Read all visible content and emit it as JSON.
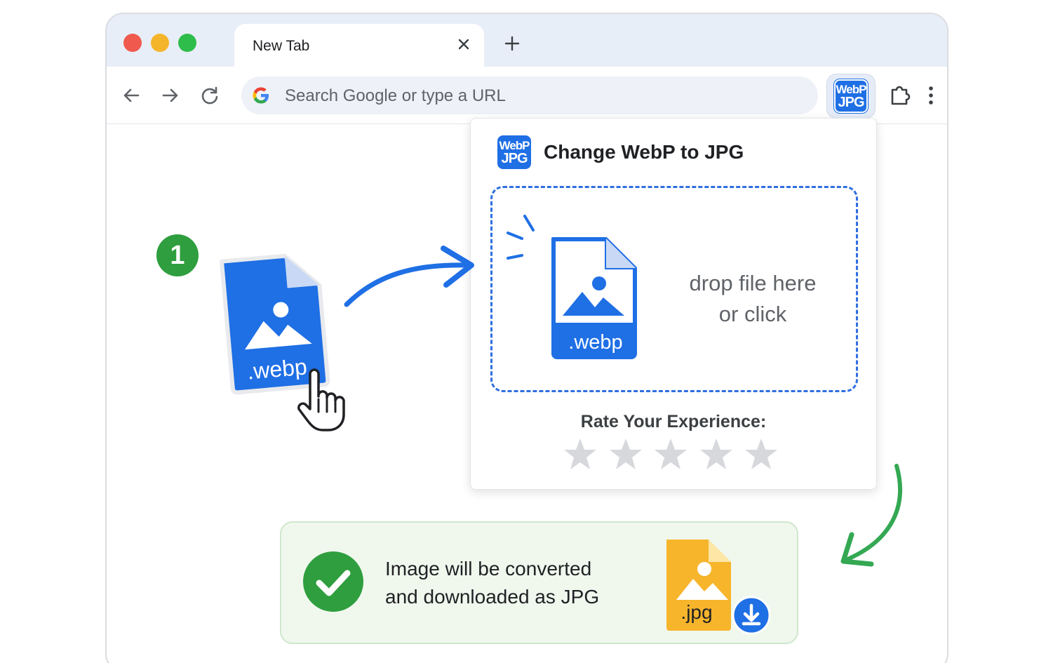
{
  "window": {
    "tab_title": "New Tab"
  },
  "toolbar": {
    "omnibox_placeholder": "Search Google or type a URL",
    "extension_icon": {
      "line1": "WebP",
      "line2": "JPG"
    }
  },
  "popup": {
    "title": "Change WebP to JPG",
    "logo": {
      "line1": "WebP",
      "line2": "JPG"
    },
    "dropzone": {
      "file_ext": ".webp",
      "line1": "drop file here",
      "line2": "or click"
    },
    "rating": {
      "label": "Rate Your Experience:",
      "max_stars": 5,
      "selected": 0
    }
  },
  "illustration": {
    "step_number": "1",
    "dragged_file_ext": ".webp"
  },
  "result": {
    "line1": "Image will be converted",
    "line2": "and downloaded as JPG",
    "file_ext": ".jpg"
  },
  "colors": {
    "accent_blue": "#1f6fe5",
    "success_green": "#2f9e3e",
    "jpg_yellow": "#f7b52c",
    "star_gray": "#d6d8dc"
  },
  "icons": [
    "close-icon",
    "plus-icon",
    "back-arrow-icon",
    "forward-arrow-icon",
    "reload-icon",
    "google-g-icon",
    "puzzle-icon",
    "kebab-menu-icon",
    "image-icon",
    "star-icon",
    "hand-pointer-icon",
    "check-circle-icon",
    "download-icon"
  ]
}
